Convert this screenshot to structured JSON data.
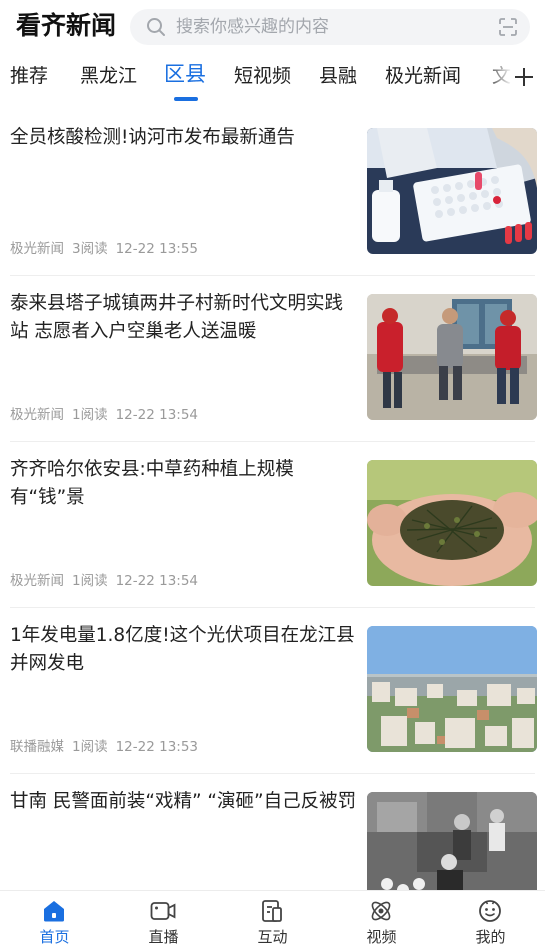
{
  "header": {
    "logo": "看齐新闻",
    "search_placeholder": "搜索你感兴趣的内容"
  },
  "tabs": [
    {
      "label": "推荐"
    },
    {
      "label": "黑龙江"
    },
    {
      "label": "区县",
      "active": true
    },
    {
      "label": "短视频"
    },
    {
      "label": "县融"
    },
    {
      "label": "极光新闻"
    },
    {
      "label": "文"
    }
  ],
  "articles": [
    {
      "title": "全员核酸检测!讷河市发布最新通告",
      "source": "极光新闻",
      "reads": "3阅读",
      "time": "12-22 13:55",
      "thumb": "covid-test-photo"
    },
    {
      "title": "泰来县塔子城镇两井子村新时代文明实践站 志愿者入户空巢老人送温暖",
      "source": "极光新闻",
      "reads": "1阅读",
      "time": "12-22 13:54",
      "thumb": "volunteers-visit-photo"
    },
    {
      "title": "齐齐哈尔依安县:中草药种植上规模有“钱”景",
      "source": "极光新闻",
      "reads": "1阅读",
      "time": "12-22 13:54",
      "thumb": "herbal-medicine-photo"
    },
    {
      "title": "1年发电量1.8亿度!这个光伏项目在龙江县并网发电",
      "source": "联播融媒",
      "reads": "1阅读",
      "time": "12-22 13:53",
      "thumb": "town-aerial-photo"
    },
    {
      "title": "甘南 民警面前装“戏精” “演砸”自己反被罚",
      "source": "",
      "reads": "",
      "time": "",
      "thumb": "police-cctv-photo"
    }
  ],
  "bottom_nav": [
    {
      "label": "首页",
      "icon": "home-icon",
      "active": true
    },
    {
      "label": "直播",
      "icon": "live-camera-icon"
    },
    {
      "label": "互动",
      "icon": "interact-icon"
    },
    {
      "label": "视频",
      "icon": "video-icon"
    },
    {
      "label": "我的",
      "icon": "profile-icon"
    }
  ],
  "colors": {
    "accent": "#1a6fe0",
    "text": "#222222",
    "meta": "#9a9a9a",
    "logo_dot": "#e53935"
  }
}
